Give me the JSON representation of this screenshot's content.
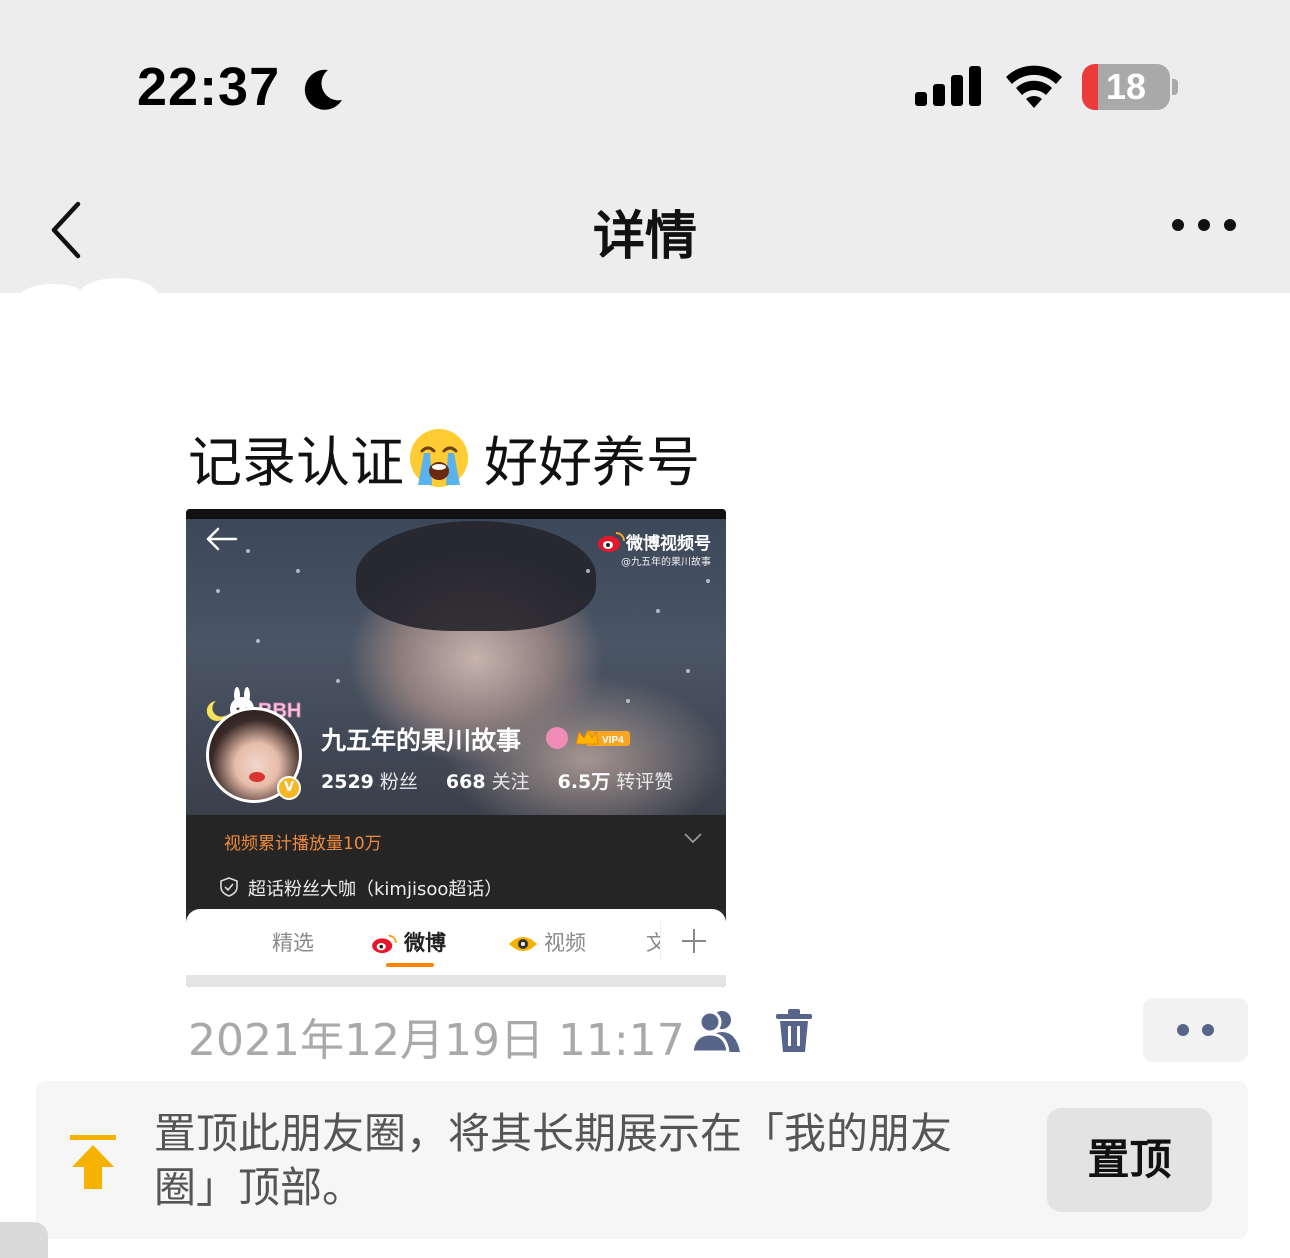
{
  "status_bar": {
    "time": "22:37",
    "battery_level": "18",
    "battery_fraction": 0.18,
    "icons": [
      "moon-icon",
      "signal-icon",
      "wifi-icon",
      "battery-icon"
    ]
  },
  "nav": {
    "title": "详情",
    "back_icon": "chevron-left-icon",
    "more_icon": "ellipsis-icon"
  },
  "post": {
    "text_before": "记录认证",
    "emoji": "loudly-crying-face",
    "text_after": "好好养号",
    "shared_image": {
      "watermark_title": "微博视频号",
      "watermark_sub": "@九五年的果川故事",
      "sticker_text": "BBH",
      "profile_name": "九五年的果川故事",
      "vip_label": "VIP4",
      "stats": [
        {
          "value": "2529",
          "label": "粉丝"
        },
        {
          "value": "668",
          "label": "关注"
        },
        {
          "value": "6.5万",
          "label": "转评赞"
        }
      ],
      "play_count": "视频累计播放量10万",
      "fan_title": "超话粉丝大咖（kimjisoo超话）",
      "tabs": [
        {
          "label": "精选"
        },
        {
          "label": "微博",
          "active": true
        },
        {
          "label": "视频"
        },
        {
          "label": "文"
        }
      ],
      "add_tab": "+"
    }
  },
  "meta": {
    "timestamp": "2021年12月19日 11:17",
    "icons": [
      "people-icon",
      "trash-icon",
      "more-dots-icon"
    ]
  },
  "pin_banner": {
    "text": "置顶此朋友圈，将其长期展示在「我的朋友圈」顶部。",
    "button_label": "置顶",
    "icon": "pin-top-icon",
    "accent_color": "#f5b300"
  },
  "colors": {
    "nav_background": "#ededed",
    "timestamp_gray": "#a9a9a9",
    "link_blue": "#57658a",
    "orange": "#ff8200"
  }
}
